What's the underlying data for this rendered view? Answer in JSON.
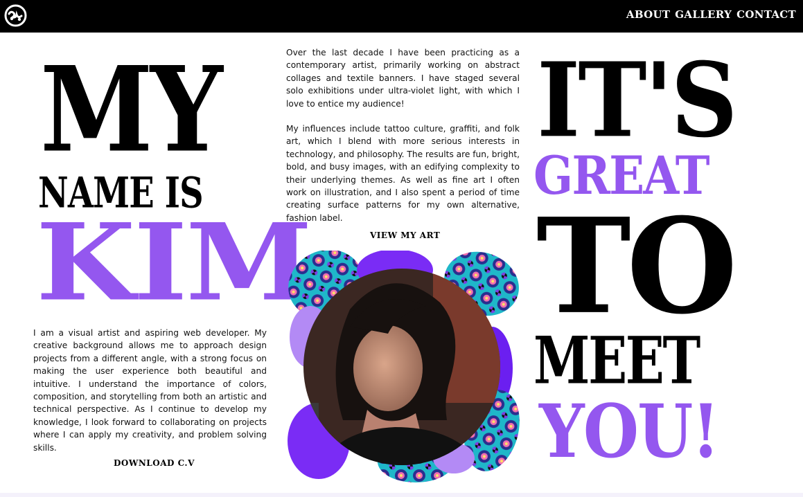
{
  "header": {
    "logo": "logo-icon",
    "nav": [
      "ABOUT",
      "GALLERY",
      "CONTACT"
    ]
  },
  "left_heading": {
    "line1": "MY",
    "line2": "NAME IS",
    "line3": "KIM"
  },
  "left_bio": "I am a visual artist and aspiring web developer. My creative background allows me to approach design projects from a different angle, with a strong focus on making the user experience both beautiful and intuitive. I understand the importance of colors, composition, and storytelling from both an artistic and technical perspective. As I continue to develop my knowledge, I look forward to collaborating on projects where I can apply my creativity, and problem solving skills.",
  "download_label": "DOWNLOAD C.V",
  "center_para1": "Over the last decade I have been practicing as a contemporary artist, primarily working on abstract collages and textile banners. I have staged several solo exhibitions under ultra-violet light, with which I love to entice my audience!",
  "center_para2": "My influences include tattoo culture, graffiti, and folk art, which I blend with more serious interests in technology, and philosophy. The results are fun, bright, bold, and busy images, with an edifying complexity to their underlying themes. As well as fine art I often work on illustration, and I also spent a period of time creating surface patterns for my own alternative, fashion label.",
  "view_art_label": "VIEW MY ART",
  "right_heading": {
    "line1": "IT'S",
    "line2": "GREAT",
    "line3": "TO",
    "line4": "MEET",
    "line5": "YOU!"
  },
  "colors": {
    "accent": "#9457ef",
    "dark": "#000000",
    "bg": "#ffffff"
  }
}
